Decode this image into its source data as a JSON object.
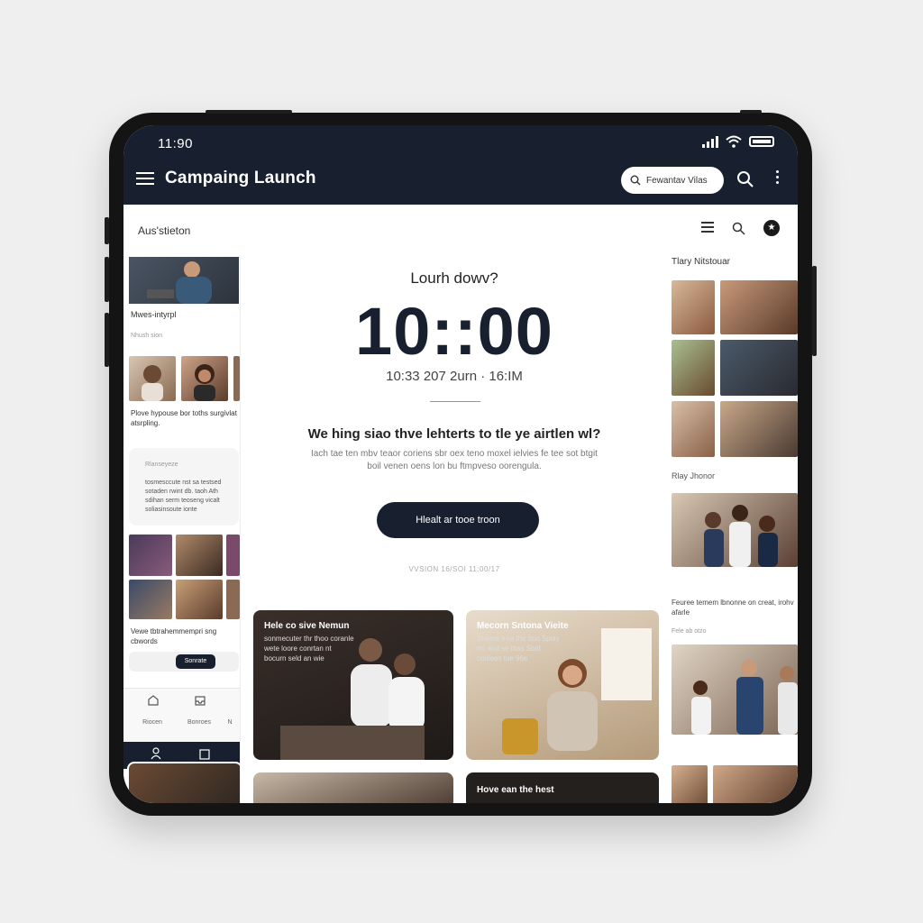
{
  "status_bar": {
    "time": "11:90"
  },
  "app": {
    "title": "Campaing Launch",
    "search_placeholder": "Fewantav Vilas"
  },
  "subbar": {
    "left_label": "Aus'stieton"
  },
  "left": {
    "caption1": "Mwes-intyrpl",
    "caption1_muted": "Nhush sion",
    "caption2": "Plove hypouse bor toths surgivlat atsrpling.",
    "card_title": "Rlanseyeze",
    "card_lines": [
      "tosmesccute nst sa testsed",
      "sotaden rwint db. taoh Ath",
      "sdihan serm teoseng vicalt",
      "soliasinsoute ionte"
    ],
    "caption3": "Vewe tbtrahemmempri sng cbwords",
    "button_label": "Sonrate",
    "tabs": [
      "Riocen",
      "Bonroes",
      "N"
    ]
  },
  "center": {
    "countdown_label": "Lourh dowv?",
    "countdown_time": "10::00",
    "countdown_date": "10:33 207 2urn · 16:IM",
    "headline": "We hing siao thve lehterts to tle ye airtlen wl?",
    "body_line1": "Iach tae ten mbv teaor coriens sbr oex teno moxel ielvies fe tee sot btgit",
    "body_line2": "boil venen oens lon bu ftmpveso oorengula.",
    "cta_label": "Hlealt ar tooe troon",
    "fine_print": "VVSION 16/SOI 11:00/17",
    "card1_title": "Hele co sive Nemun",
    "card1_sub": "sonmecuter thr thoo coranle wete loore conrtan nt bocurn seld an wie",
    "card2_title": "Mecorn Sntona Vieite",
    "card2_sub": "Shame trea the ttoo 5piay tro and se ittas Sbid couioes tue 96e",
    "card4_title": "Hove ean the hest"
  },
  "right": {
    "title1": "Tlary Nitstouar",
    "title2": "Rlay Jhonor",
    "caption1": "Feuree temem lbnonne on creat, irohv afarle",
    "caption1_muted": "Fele ab otzo"
  },
  "colors": {
    "navy": "#18202f",
    "background": "#efefef"
  }
}
